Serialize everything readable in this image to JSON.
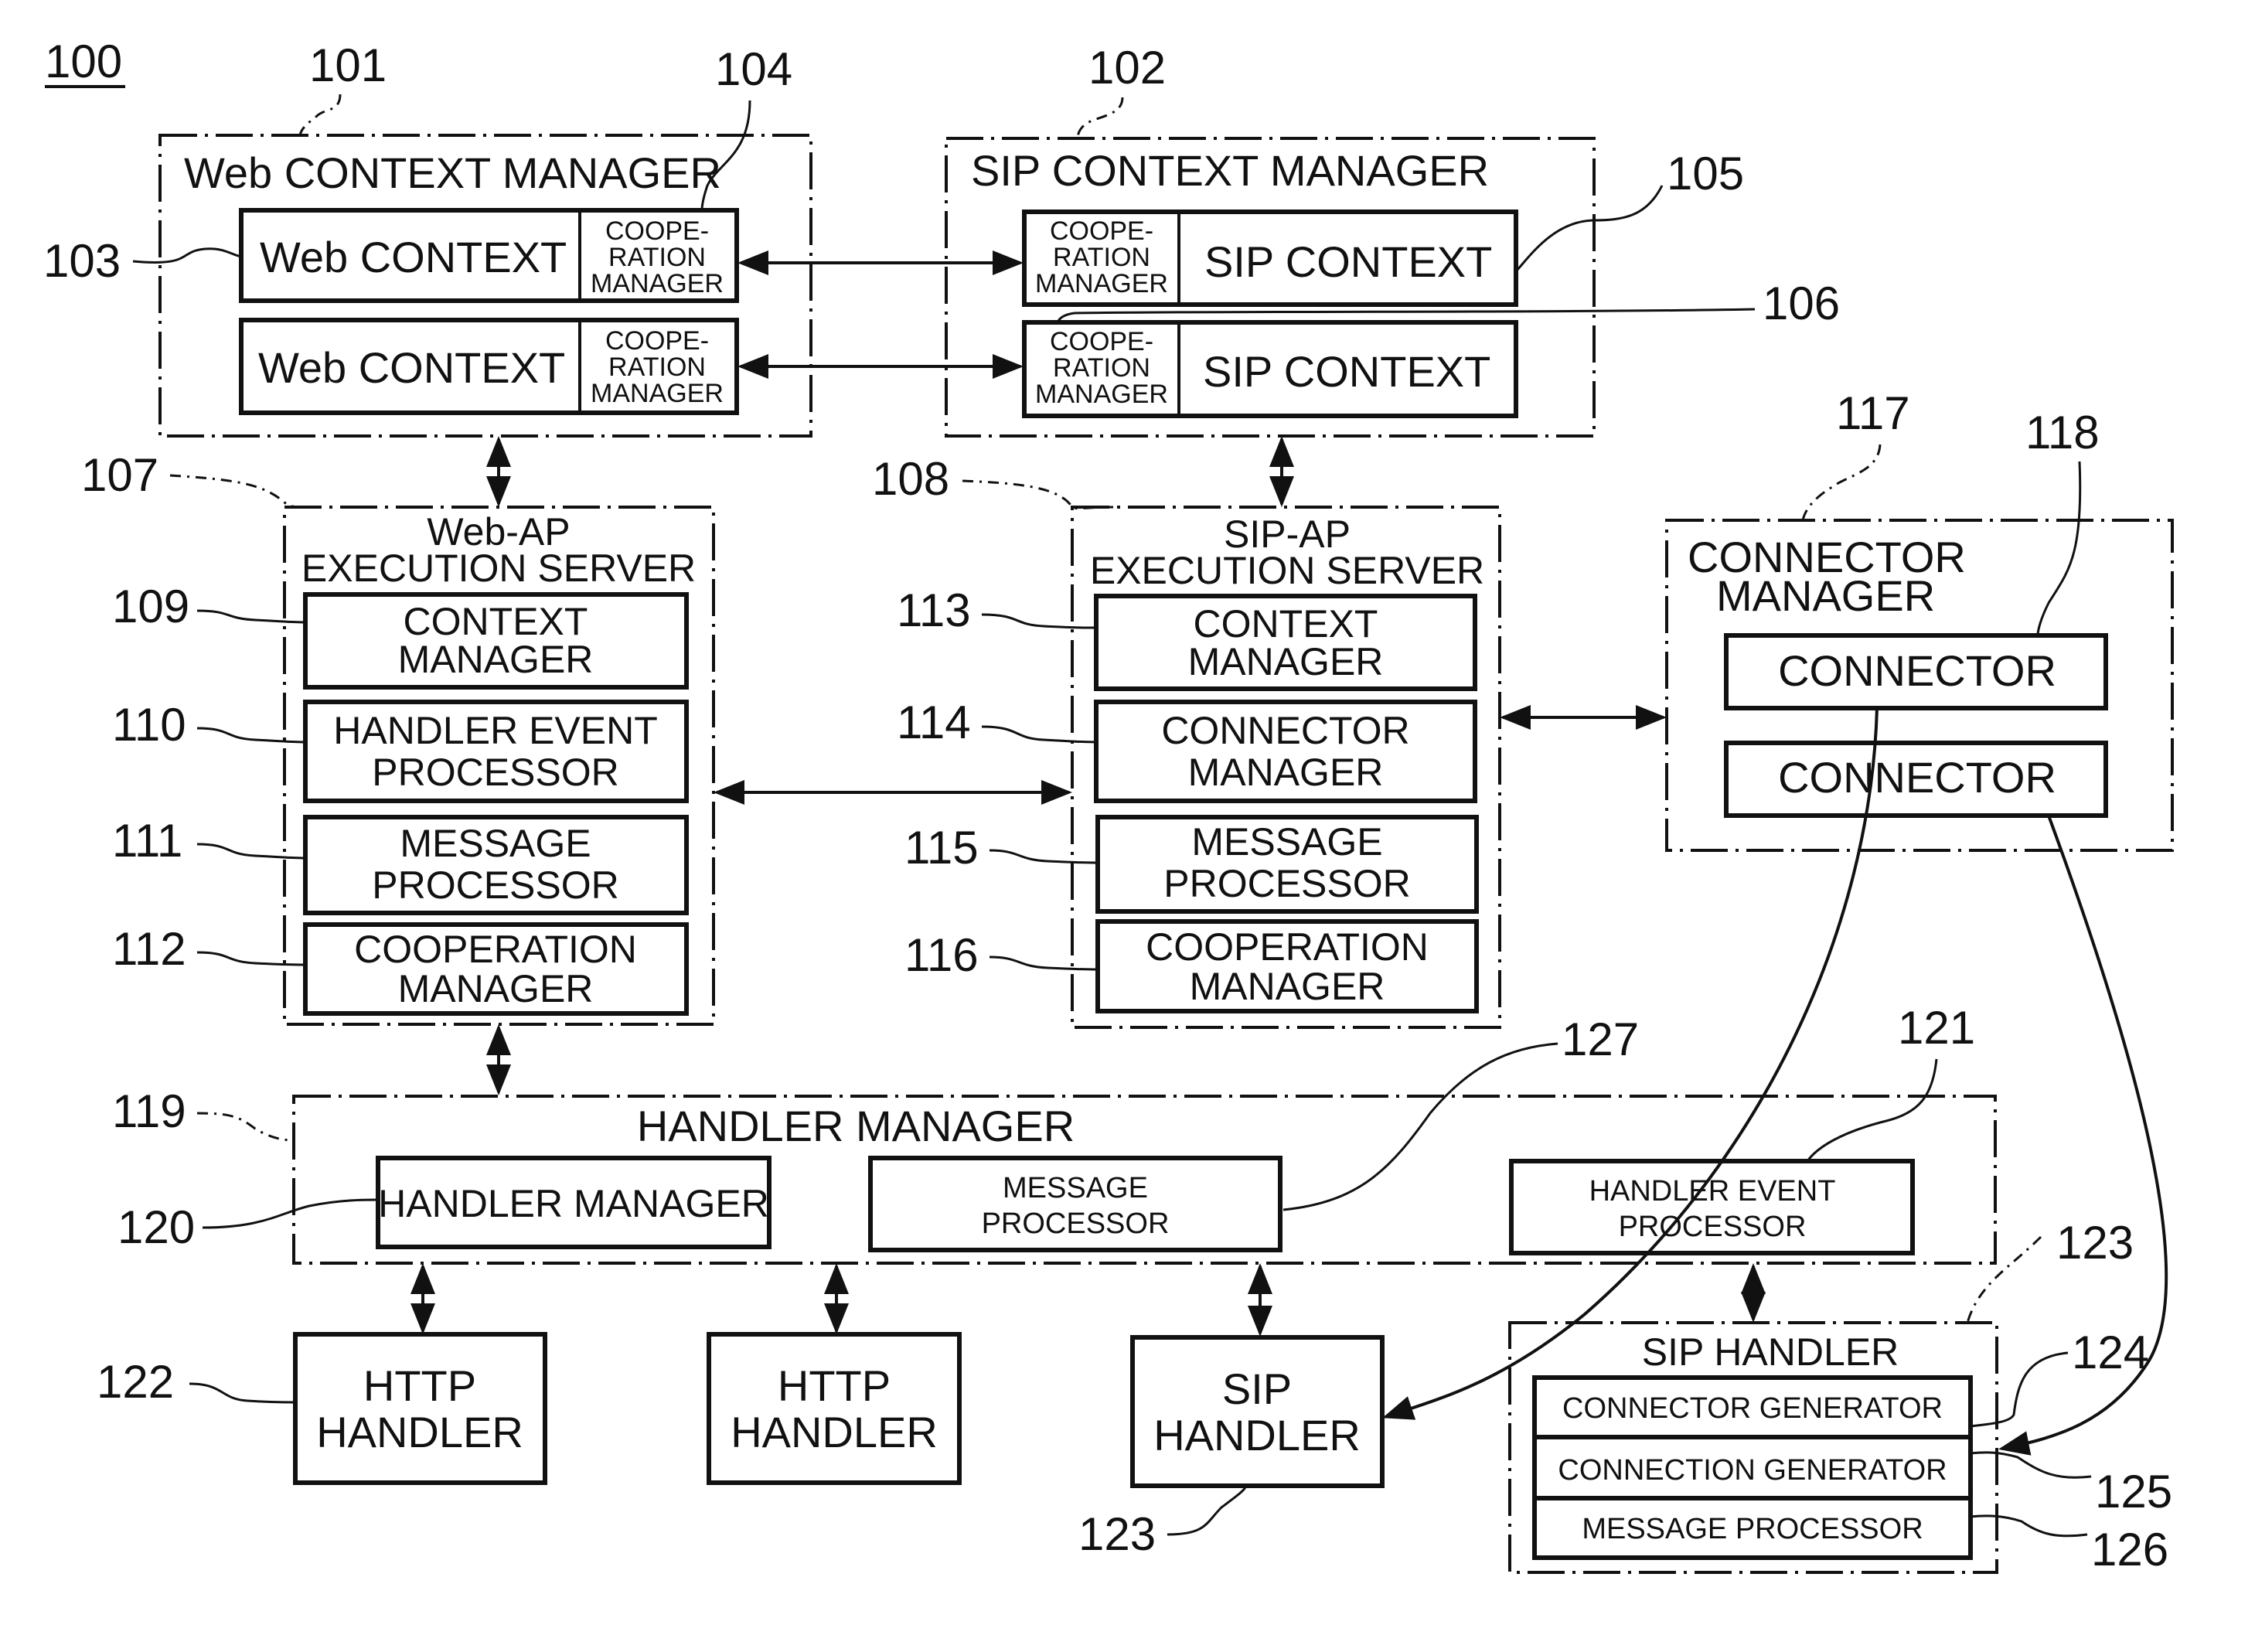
{
  "figure_number": "100",
  "ref_labels": {
    "web_context_manager": "101",
    "sip_context_manager": "102",
    "web_context": "103",
    "web_cooperation_manager": "104",
    "sip_context": "105",
    "sip_cooperation_manager": "106",
    "web_ap_server": "107",
    "sip_ap_server": "108",
    "web_context_manager_mod": "109",
    "web_handler_event_processor": "110",
    "web_message_processor": "111",
    "web_cooperation_manager_mod": "112",
    "sip_context_manager_mod": "113",
    "sip_connector_manager_mod": "114",
    "sip_message_processor": "115",
    "sip_cooperation_manager_mod": "116",
    "connector_manager": "117",
    "connector": "118",
    "handler_manager": "119",
    "handler_manager_mod": "120",
    "handler_event_processor": "121",
    "http_handler": "122",
    "sip_handler": "123",
    "sip_handler_box": "123",
    "connector_generator": "124",
    "connection_generator": "125",
    "sip_message_processor_mod": "126",
    "message_processor": "127"
  },
  "web_context_manager": {
    "title": "Web CONTEXT MANAGER",
    "contexts": [
      {
        "label": "Web CONTEXT",
        "coop": [
          "COOPE-",
          "RATION",
          "MANAGER"
        ]
      },
      {
        "label": "Web CONTEXT",
        "coop": [
          "COOPE-",
          "RATION",
          "MANAGER"
        ]
      }
    ]
  },
  "sip_context_manager": {
    "title": "SIP CONTEXT MANAGER",
    "contexts": [
      {
        "label": "SIP CONTEXT",
        "coop": [
          "COOPE-",
          "RATION",
          "MANAGER"
        ]
      },
      {
        "label": "SIP CONTEXT",
        "coop": [
          "COOPE-",
          "RATION",
          "MANAGER"
        ]
      }
    ]
  },
  "web_ap_server": {
    "title": [
      "Web-AP",
      "EXECUTION SERVER"
    ],
    "modules": [
      [
        "CONTEXT",
        "MANAGER"
      ],
      [
        "HANDLER EVENT",
        "PROCESSOR"
      ],
      [
        "MESSAGE",
        "PROCESSOR"
      ],
      [
        "COOPERATION",
        "MANAGER"
      ]
    ]
  },
  "sip_ap_server": {
    "title": [
      "SIP-AP",
      "EXECUTION SERVER"
    ],
    "modules": [
      [
        "CONTEXT",
        "MANAGER"
      ],
      [
        "CONNECTOR",
        "MANAGER"
      ],
      [
        "MESSAGE",
        "PROCESSOR"
      ],
      [
        "COOPERATION",
        "MANAGER"
      ]
    ]
  },
  "connector_manager": {
    "title": [
      "CONNECTOR",
      "MANAGER"
    ],
    "connectors": [
      "CONNECTOR",
      "CONNECTOR"
    ]
  },
  "handler_manager": {
    "title": "HANDLER MANAGER",
    "modules": [
      [
        "HANDLER MANAGER"
      ],
      [
        "MESSAGE",
        "PROCESSOR"
      ],
      [
        "HANDLER EVENT",
        "PROCESSOR"
      ]
    ]
  },
  "handlers": [
    [
      "HTTP",
      "HANDLER"
    ],
    [
      "HTTP",
      "HANDLER"
    ],
    [
      "SIP",
      "HANDLER"
    ]
  ],
  "sip_handler": {
    "title": "SIP HANDLER",
    "modules": [
      "CONNECTOR GENERATOR",
      "CONNECTION GENERATOR",
      "MESSAGE PROCESSOR"
    ]
  }
}
